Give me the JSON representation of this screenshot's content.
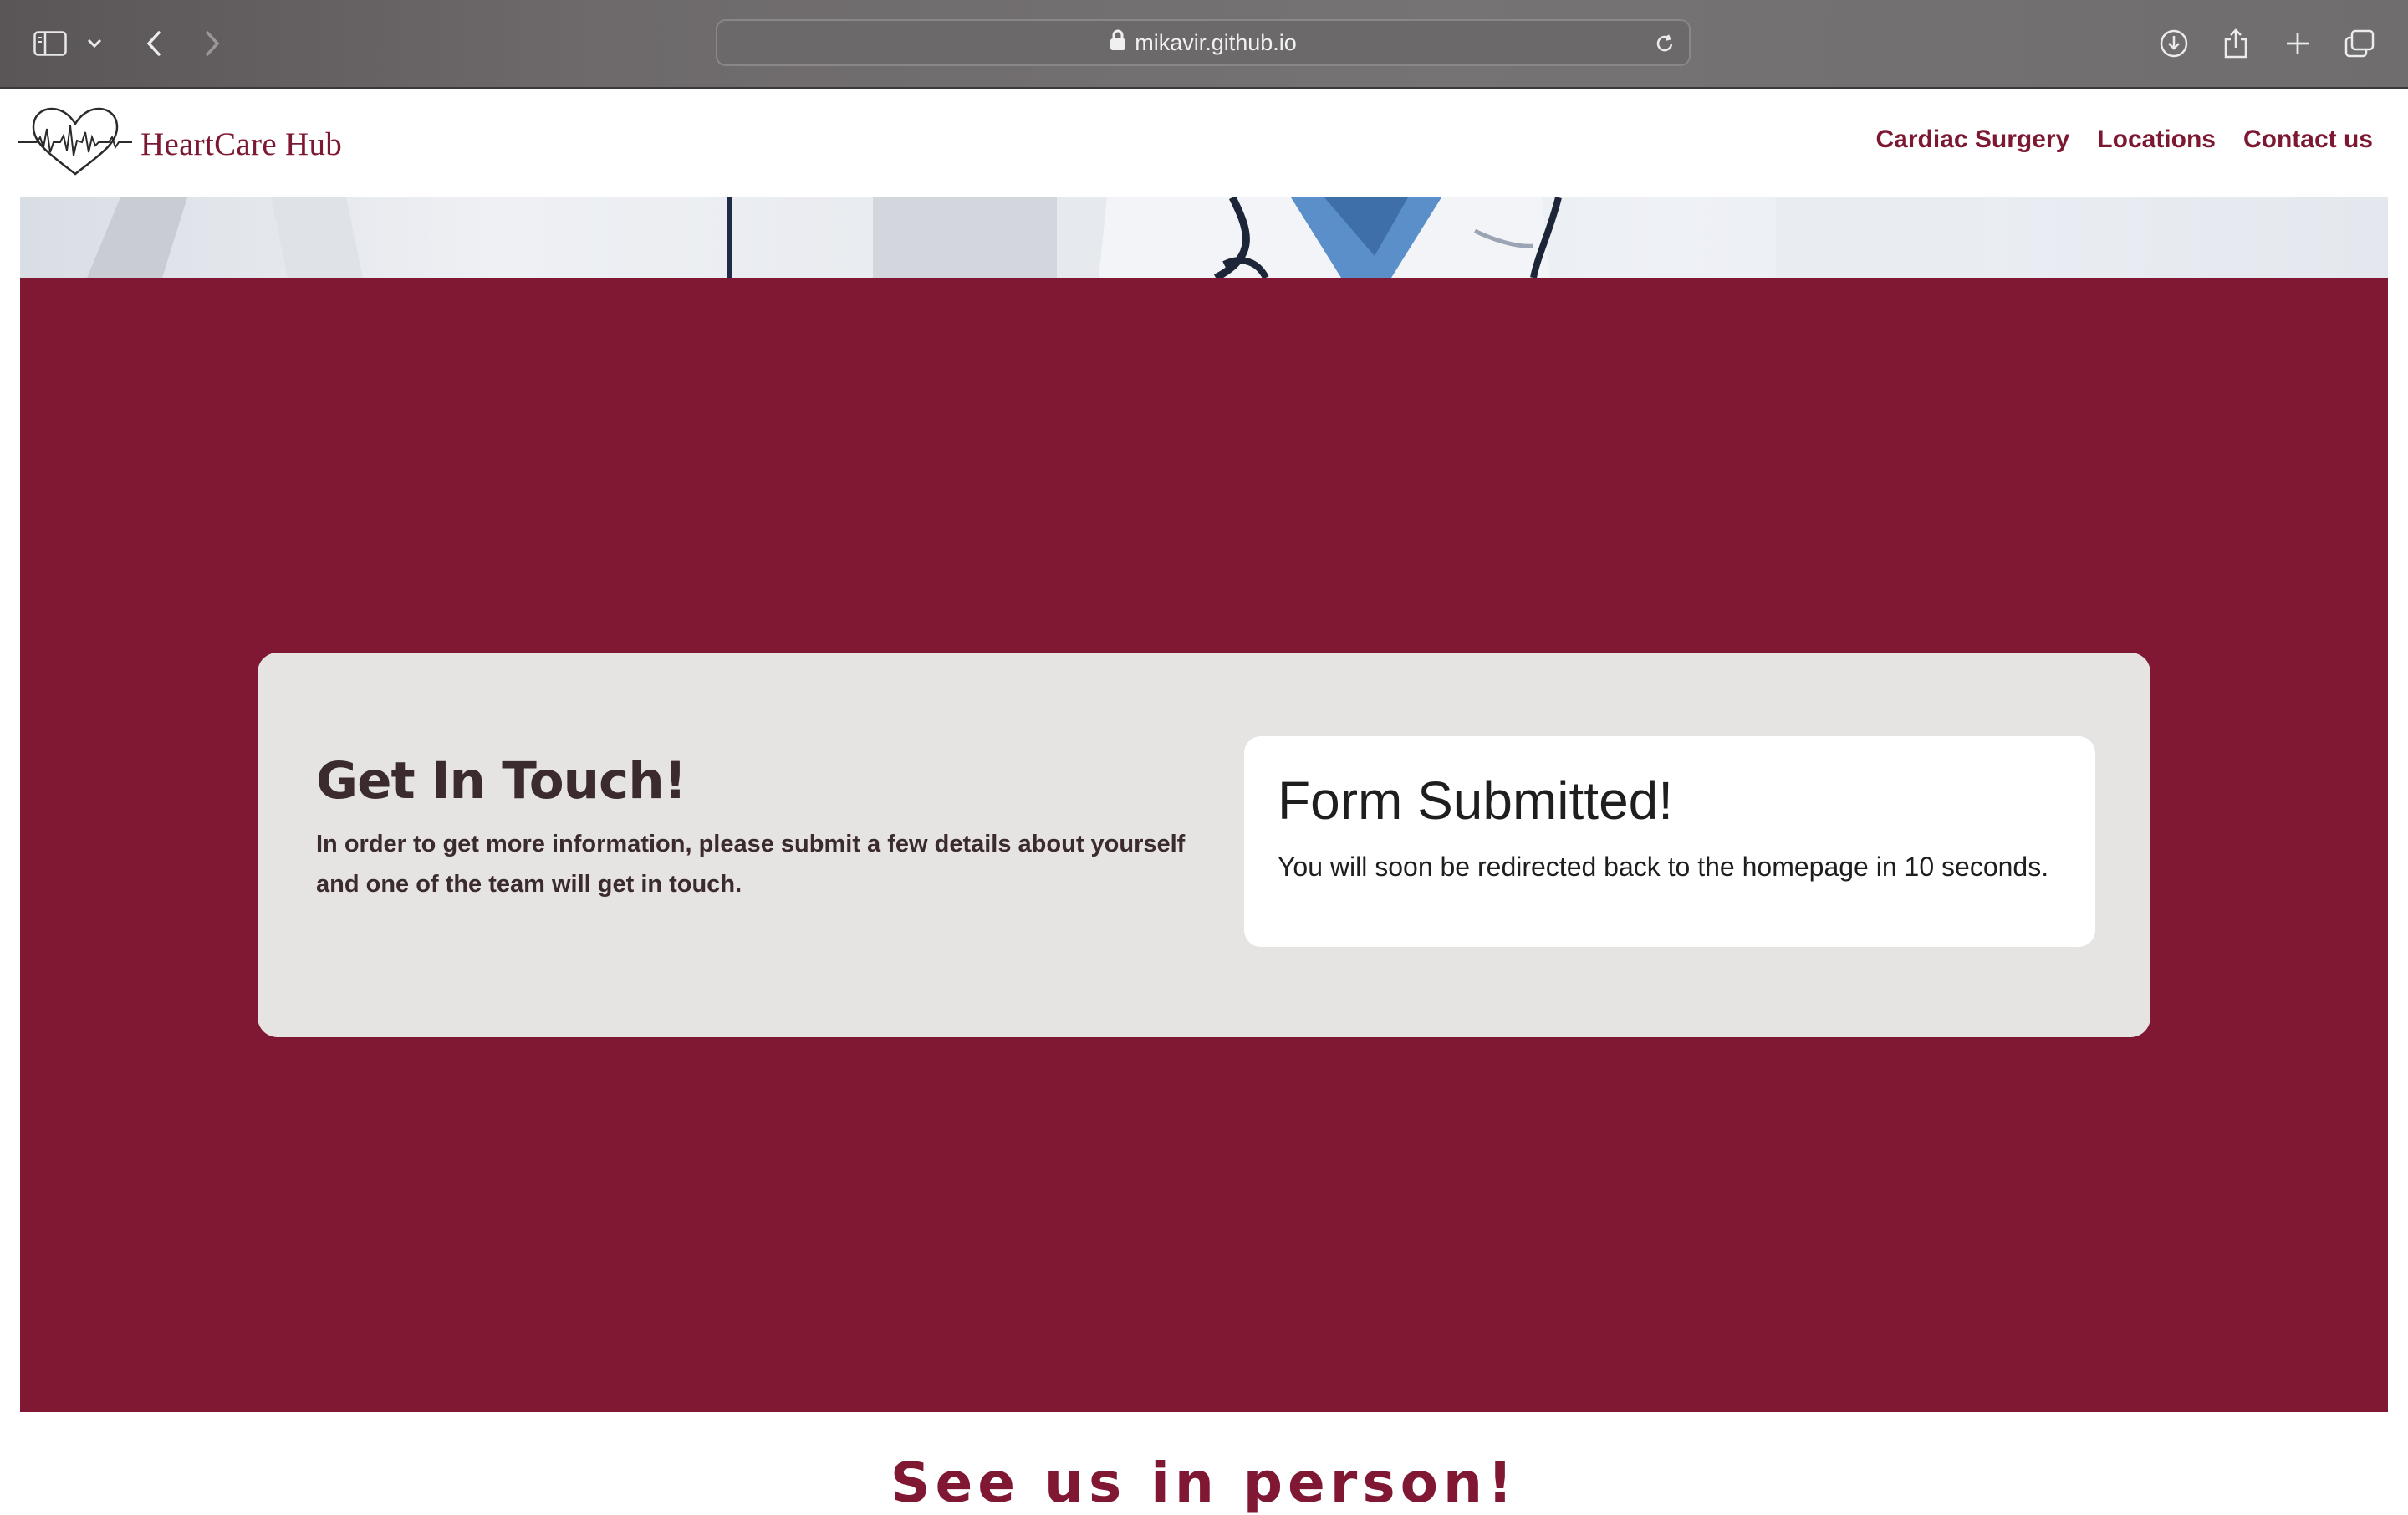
{
  "browser": {
    "url": "mikavir.github.io",
    "icons": {
      "sidebar": "sidebar-icon",
      "chevron": "chevron-down-icon",
      "back": "back-arrow-icon",
      "forward": "forward-arrow-icon",
      "lock": "lock-icon",
      "reload": "reload-icon",
      "download": "download-icon",
      "share": "share-icon",
      "new_tab": "plus-icon",
      "tabs": "tab-overview-icon"
    }
  },
  "site": {
    "brand": "HeartCare Hub",
    "brand_color": "#7d1832",
    "nav": [
      {
        "label": "Cardiac Surgery"
      },
      {
        "label": "Locations"
      },
      {
        "label": "Contact us"
      }
    ]
  },
  "contact": {
    "heading": "Get In Touch!",
    "body": "In order to get more information, please submit a few details about yourself and one of the team will get in touch.",
    "band_color": "#801834"
  },
  "confirmation": {
    "title": "Form Submitted!",
    "message": "You will soon be redirected back to the homepage in 10 seconds."
  },
  "next_section": {
    "heading": "See us in person!"
  }
}
